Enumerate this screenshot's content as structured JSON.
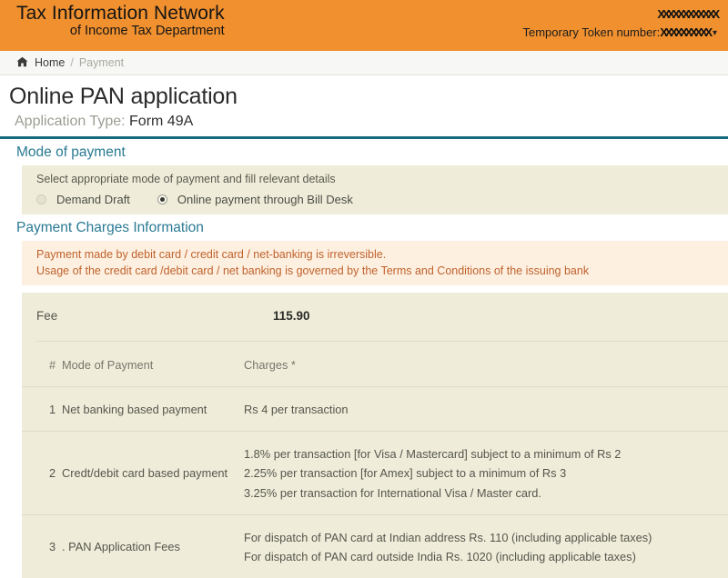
{
  "header": {
    "brand_line1": "Tax Information Network",
    "brand_line2": "of Income Tax Department",
    "user_name": "XXXXXXXXXXXX",
    "token_label": "Temporary Token number:",
    "token_value": "XXXXXXXXXX",
    "caret_icon": "chevron-down-icon",
    "bg_color": "#f0902f"
  },
  "breadcrumb": {
    "home_icon": "home-icon",
    "home_label": "Home",
    "separator": "/",
    "current": "Payment"
  },
  "page": {
    "title": "Online PAN application",
    "application_type_label": "Application Type:",
    "application_type_value": "Form 49A",
    "rule_color": "#15697d"
  },
  "mode_of_payment": {
    "heading": "Mode of payment",
    "instruction": "Select appropriate mode of payment and fill relevant details",
    "options": [
      {
        "label": "Demand Draft",
        "selected": false
      },
      {
        "label": "Online payment through Bill Desk",
        "selected": true
      }
    ]
  },
  "payment_charges": {
    "heading": "Payment Charges Information",
    "warnings": [
      "Payment made by debit card / credit card / net-banking is irreversible.",
      "Usage of the credit card /debit card / net banking is governed by the Terms and Conditions of the issuing bank"
    ],
    "fee_label": "Fee",
    "fee_value": "115.90",
    "table": {
      "columns": [
        "#",
        "Mode of Payment",
        "Charges *"
      ],
      "rows": [
        {
          "num": "1",
          "mode": "Net banking based payment",
          "charges": [
            "Rs 4 per transaction"
          ]
        },
        {
          "num": "2",
          "mode": "Credt/debit card based payment",
          "charges": [
            "1.8% per transaction [for Visa / Mastercard] subject to a minimum of Rs 2",
            "2.25% per transaction [for Amex] subject to a minimum of Rs 3",
            "3.25% per transaction for International Visa / Master card."
          ]
        },
        {
          "num": "3",
          "mode": ". PAN Application Fees",
          "charges": [
            "For dispatch of PAN card at Indian address Rs. 110 (including applicable taxes)",
            "For dispatch of PAN card outside India Rs. 1020 (including applicable taxes)"
          ]
        }
      ]
    }
  },
  "colors": {
    "brand_orange": "#f0902f",
    "teal_heading": "#2a7a93",
    "teal_rule": "#15697d",
    "panel_beige": "#efedda",
    "warn_peach": "#fdf0e1",
    "warn_text": "#c0622c"
  }
}
